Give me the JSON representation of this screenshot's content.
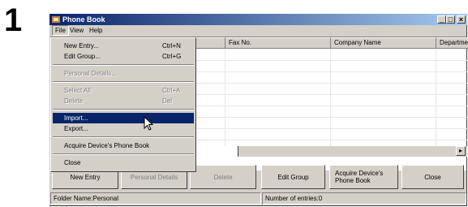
{
  "step_number": "1",
  "window": {
    "title": "Phone Book",
    "controls": [
      "_",
      "□",
      "×"
    ]
  },
  "menubar": {
    "file": "File",
    "view": "View",
    "help": "Help"
  },
  "columns": [
    "Fax No.",
    "Company Name",
    "Departme"
  ],
  "file_menu": {
    "items": [
      {
        "label": "New Entry...",
        "shortcut": "Ctrl+N",
        "enabled": true
      },
      {
        "label": "Edit Group...",
        "shortcut": "Ctrl+G",
        "enabled": true
      },
      {
        "label": "Personal Details...",
        "shortcut": "",
        "enabled": false
      },
      {
        "label": "Select All",
        "shortcut": "Ctrl+A",
        "enabled": false
      },
      {
        "label": "Delete",
        "shortcut": "Del",
        "enabled": false
      },
      {
        "label": "Import...",
        "shortcut": "",
        "enabled": true,
        "highlighted": true
      },
      {
        "label": "Export...",
        "shortcut": "",
        "enabled": true
      },
      {
        "label": "Acquire Device's Phone Book",
        "shortcut": "",
        "enabled": true
      },
      {
        "label": "Close",
        "shortcut": "",
        "enabled": true
      }
    ]
  },
  "buttons": {
    "new_entry": "New Entry",
    "personal_details": "Personal Details",
    "delete": "Delete",
    "edit_group": "Edit Group",
    "acquire": "Acquire Device's Phone Book",
    "close": "Close"
  },
  "status": {
    "folder": "Folder Name:Personal",
    "entries": "Number of entries:0"
  },
  "colors": {
    "titlebar_start": "#0a246a",
    "titlebar_end": "#a6caf0",
    "menu_highlight": "#0a246a",
    "face": "#d4d0c8"
  },
  "icons": [
    "phone-book-app-icon",
    "mouse-pointer-icon",
    "scroll-right-icon"
  ]
}
